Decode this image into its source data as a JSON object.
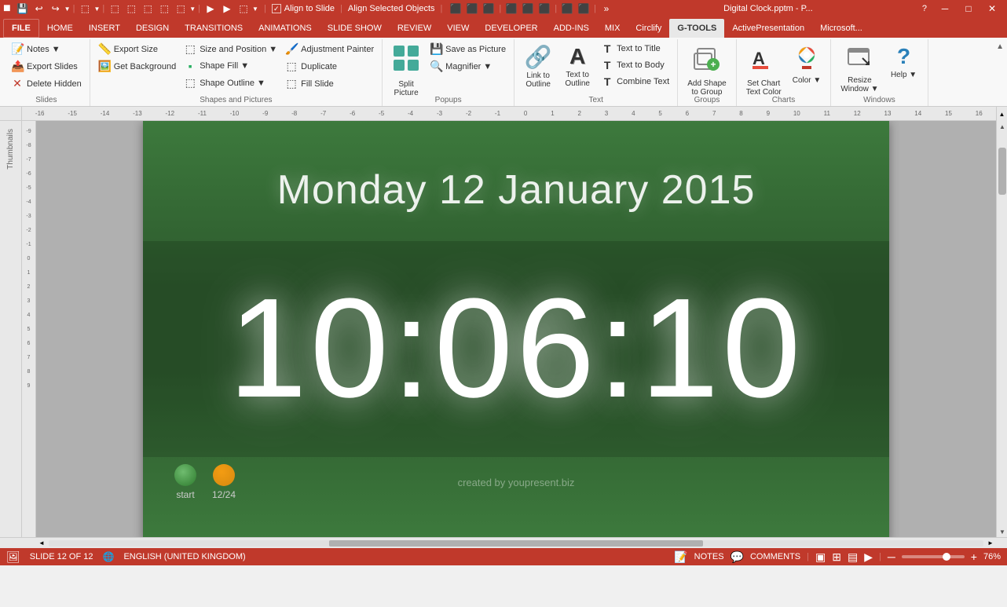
{
  "titlebar": {
    "title": "Digital Clock.pptm - P...",
    "help_icon": "?",
    "minimize": "─",
    "maximize": "□",
    "close": "✕"
  },
  "quickaccess": {
    "buttons": [
      "■",
      "↩",
      "↪",
      "▼",
      "|",
      "⚫",
      "▼",
      "|",
      "⬚",
      "⬚",
      "⬚",
      "⬚",
      "⬚",
      "▼",
      "|",
      "⬚",
      "⬚",
      "⬚",
      "▼"
    ]
  },
  "tabs": [
    {
      "label": "FILE",
      "id": "file",
      "active": false,
      "file": true
    },
    {
      "label": "HOME",
      "id": "home",
      "active": false
    },
    {
      "label": "INSERT",
      "id": "insert",
      "active": false
    },
    {
      "label": "DESIGN",
      "id": "design",
      "active": false
    },
    {
      "label": "TRANSITIONS",
      "id": "transitions",
      "active": false
    },
    {
      "label": "ANIMATIONS",
      "id": "animations",
      "active": false
    },
    {
      "label": "SLIDE SHOW",
      "id": "slideshow",
      "active": false
    },
    {
      "label": "REVIEW",
      "id": "review",
      "active": false
    },
    {
      "label": "VIEW",
      "id": "view",
      "active": false
    },
    {
      "label": "DEVELOPER",
      "id": "developer",
      "active": false
    },
    {
      "label": "ADD-INS",
      "id": "addins",
      "active": false
    },
    {
      "label": "MIX",
      "id": "mix",
      "active": false
    },
    {
      "label": "Circlify",
      "id": "circlify",
      "active": false
    },
    {
      "label": "G-TOOLS",
      "id": "gtools",
      "active": true
    },
    {
      "label": "ActivePresentation",
      "id": "activepresentation",
      "active": false
    },
    {
      "label": "Microsoft...",
      "id": "microsoft",
      "active": false
    }
  ],
  "ribbon": {
    "groups": [
      {
        "id": "slides",
        "label": "Slides",
        "items": [
          {
            "type": "small-col",
            "buttons": [
              {
                "label": "Notes ▼",
                "icon": "📝"
              },
              {
                "label": "Export Slides",
                "icon": "📤"
              },
              {
                "label": "Delete Hidden",
                "icon": "🗑️",
                "icon_color": "red"
              }
            ]
          }
        ]
      },
      {
        "id": "shapes-pictures",
        "label": "Shapes and Pictures",
        "items": [
          {
            "type": "small-col",
            "buttons": [
              {
                "label": "Export Size",
                "icon": "📏"
              },
              {
                "label": "Get Background",
                "icon": "🖼️"
              }
            ]
          },
          {
            "type": "small-col",
            "buttons": [
              {
                "label": "Size and Position ▼",
                "icon": "⬚"
              },
              {
                "label": "Shape Fill ▼",
                "icon": "🟩"
              },
              {
                "label": "Shape Outline ▼",
                "icon": "⬚"
              }
            ]
          },
          {
            "type": "small-col",
            "buttons": [
              {
                "label": "Adjustment Painter",
                "icon": "🖌️"
              },
              {
                "label": "Duplicate",
                "icon": "⬚"
              },
              {
                "label": "Fill Slide",
                "icon": "⬚"
              }
            ]
          }
        ]
      },
      {
        "id": "popups",
        "label": "Popups",
        "items": [
          {
            "type": "large",
            "label": "Split Picture",
            "icon": "⬚"
          },
          {
            "type": "small-col",
            "buttons": [
              {
                "label": "Save as Picture",
                "icon": "💾"
              },
              {
                "label": "Magnifier ▼",
                "icon": "🔍"
              }
            ]
          }
        ]
      },
      {
        "id": "text",
        "label": "Text",
        "items": [
          {
            "type": "large",
            "label": "Link to Outline",
            "icon": "🔗"
          },
          {
            "type": "large",
            "label": "Text to Outline",
            "icon": "A"
          },
          {
            "type": "small-col",
            "buttons": [
              {
                "label": "Text to Title",
                "icon": "T"
              },
              {
                "label": "Text to Body",
                "icon": "T"
              },
              {
                "label": "Combine Text",
                "icon": "T"
              }
            ]
          }
        ]
      },
      {
        "id": "groups",
        "label": "Groups",
        "items": [
          {
            "type": "large",
            "label": "Add Shape to Group",
            "icon": "⬚"
          }
        ]
      },
      {
        "id": "charts",
        "label": "Charts",
        "items": [
          {
            "type": "large",
            "label": "Set Chart Text Color",
            "icon": "A"
          },
          {
            "type": "large",
            "label": "Color ▼",
            "icon": "🎨"
          }
        ]
      },
      {
        "id": "windows",
        "label": "Windows",
        "items": [
          {
            "type": "large",
            "label": "Resize Window ▼",
            "icon": "⬚"
          },
          {
            "type": "large",
            "label": "Help ▼",
            "icon": "?"
          }
        ]
      }
    ]
  },
  "alignment_toolbar": {
    "align_to_slide_checked": true,
    "align_to_slide_label": "Align to Slide",
    "align_selected_label": "Align Selected Objects",
    "collapse_icon": "▲"
  },
  "ruler": {
    "h_marks": [
      "-16",
      "-15",
      "-14",
      "-13",
      "-12",
      "-11",
      "-10",
      "-9",
      "-8",
      "-7",
      "-6",
      "-5",
      "-4",
      "-3",
      "-2",
      "-1",
      "0",
      "1",
      "2",
      "3",
      "4",
      "5",
      "6",
      "7",
      "8",
      "9",
      "10",
      "11",
      "12",
      "13",
      "14",
      "15",
      "16"
    ],
    "v_marks": [
      "-9",
      "-8",
      "-7",
      "-6",
      "-5",
      "-4",
      "-3",
      "-2",
      "-1",
      "0",
      "1",
      "2",
      "3",
      "4",
      "5",
      "6",
      "7",
      "8",
      "9"
    ]
  },
  "slide": {
    "date": "Monday 12 January 2015",
    "time": "10:06:10",
    "credit": "created by youpresent.biz",
    "btn_start_label": "start",
    "btn_slide_label": "12/24"
  },
  "status_bar": {
    "slide_info": "SLIDE 12 OF 12",
    "language": "ENGLISH (UNITED KINGDOM)",
    "notes_label": "NOTES",
    "comments_label": "COMMENTS",
    "zoom": "76%",
    "zoom_value": 76
  }
}
